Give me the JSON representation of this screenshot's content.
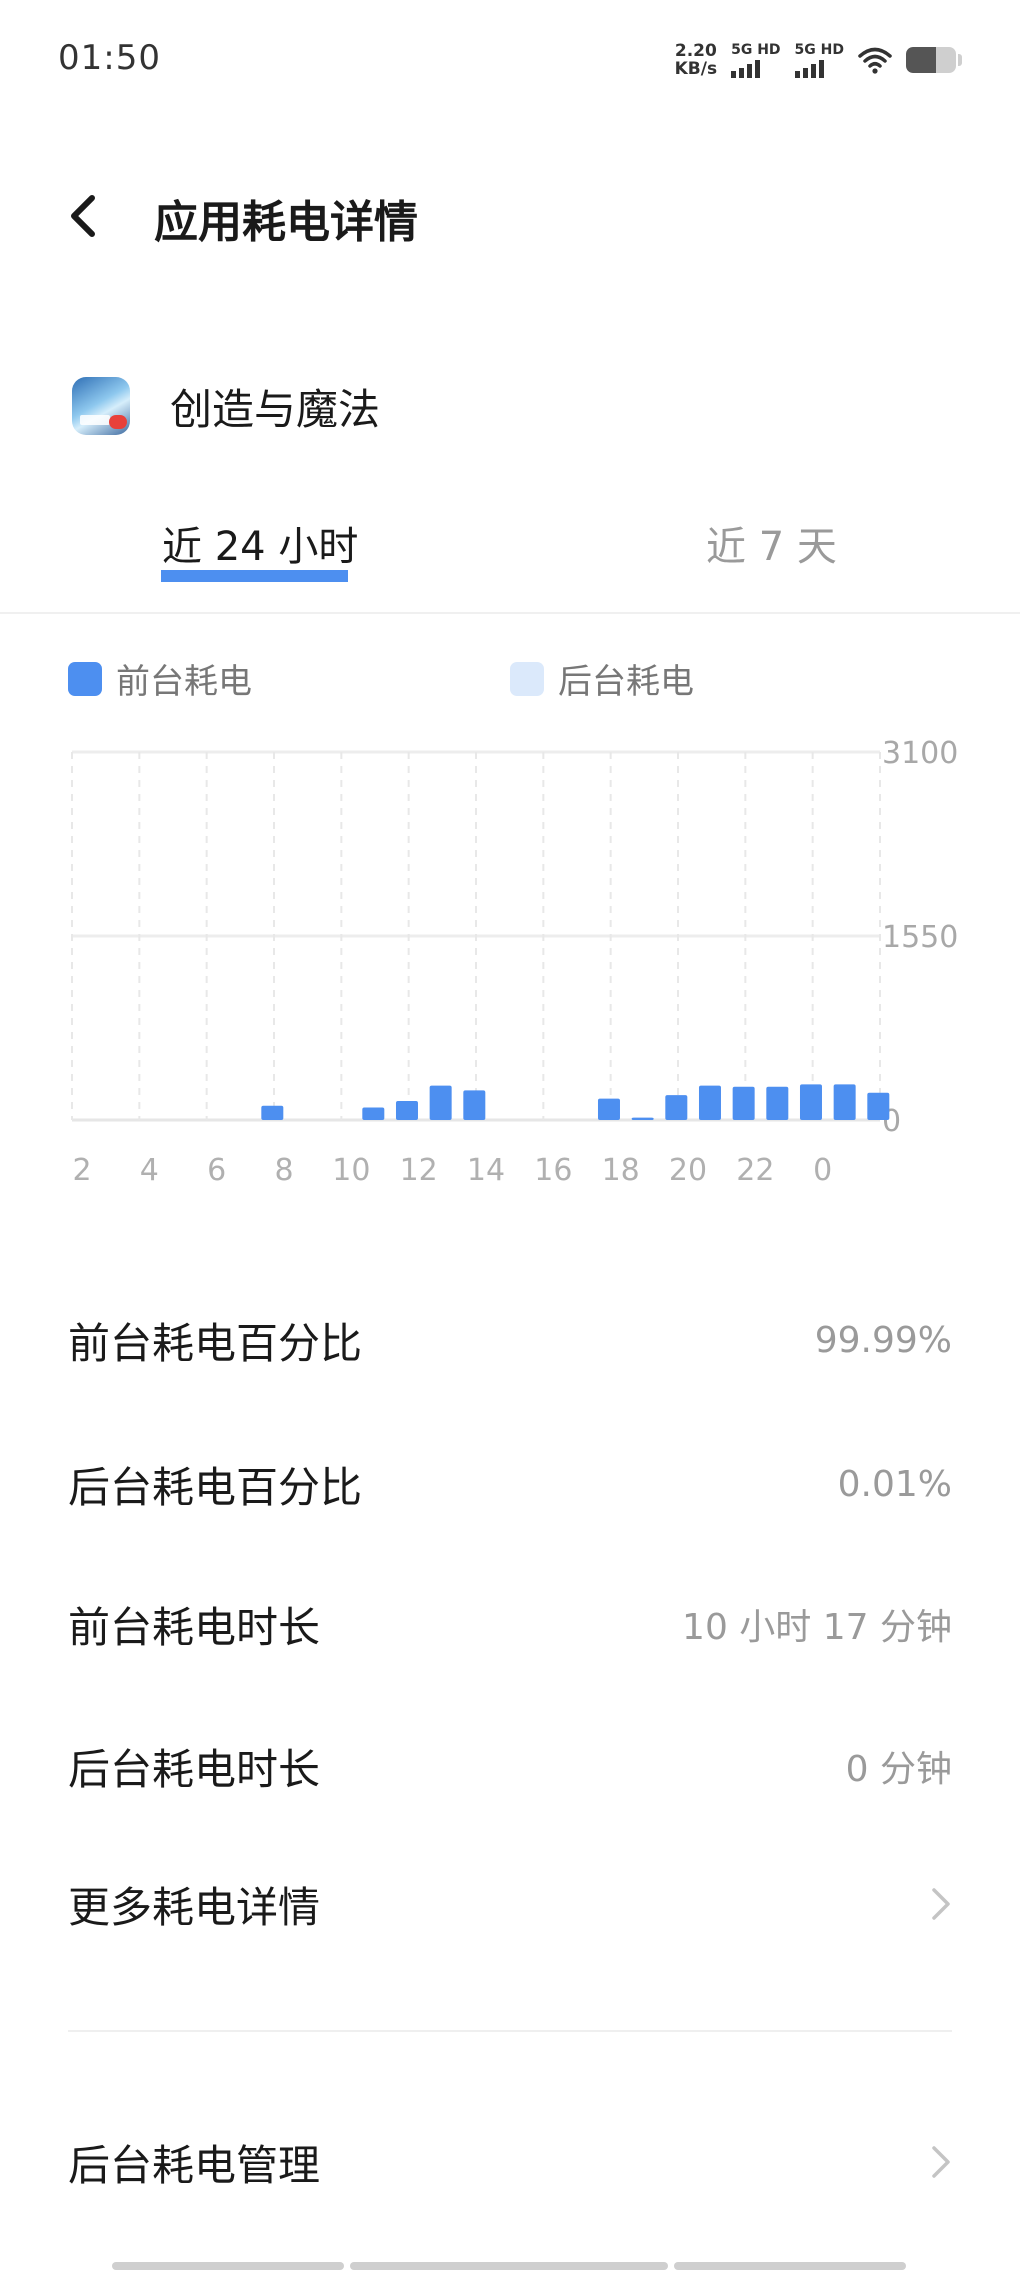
{
  "status_bar": {
    "time": "01:50",
    "net_speed_value": "2.20",
    "net_speed_unit": "KB/s",
    "sim1_label": "5G HD",
    "sim2_label": "5G HD",
    "battery_level_fraction": 0.6
  },
  "header": {
    "back_icon": "chevron-left-icon",
    "title": "应用耗电详情"
  },
  "app": {
    "name": "创造与魔法"
  },
  "tabs": [
    {
      "label": "近 24 小时",
      "selected": true
    },
    {
      "label": "近 7 天",
      "selected": false
    }
  ],
  "legend": {
    "foreground_label": "前台耗电",
    "background_label": "后台耗电",
    "foreground_color": "#4d8ff0",
    "background_color": "#dbe9fb"
  },
  "chart_data": {
    "type": "bar",
    "categories": [
      "2",
      "3",
      "4",
      "5",
      "6",
      "7",
      "8",
      "9",
      "10",
      "11",
      "12",
      "13",
      "14",
      "15",
      "16",
      "17",
      "18",
      "19",
      "20",
      "21",
      "22",
      "23",
      "0",
      "1"
    ],
    "series": [
      {
        "name": "前台耗电",
        "values": [
          0,
          0,
          0,
          0,
          0,
          120,
          0,
          0,
          105,
          160,
          290,
          250,
          0,
          0,
          0,
          180,
          20,
          210,
          290,
          280,
          280,
          300,
          300,
          230
        ]
      },
      {
        "name": "后台耗电",
        "values": [
          0,
          0,
          0,
          0,
          0,
          0,
          0,
          0,
          0,
          0,
          0,
          0,
          0,
          0,
          0,
          0,
          0,
          0,
          0,
          0,
          0,
          0,
          0,
          0
        ]
      }
    ],
    "x_tick_labels": [
      "2",
      "4",
      "6",
      "8",
      "10",
      "12",
      "14",
      "16",
      "18",
      "20",
      "22",
      "0"
    ],
    "y_tick_labels": [
      "3100",
      "1550",
      "0"
    ],
    "ylim": [
      0,
      3100
    ],
    "grid": true
  },
  "stats": [
    {
      "label": "前台耗电百分比",
      "value": "99.99%"
    },
    {
      "label": "后台耗电百分比",
      "value": "0.01%"
    },
    {
      "label": "前台耗电时长",
      "value": "10 小时 17 分钟"
    },
    {
      "label": "后台耗电时长",
      "value": "0 分钟"
    }
  ],
  "links": {
    "more_details": "更多耗电详情",
    "background_management": "后台耗电管理"
  }
}
